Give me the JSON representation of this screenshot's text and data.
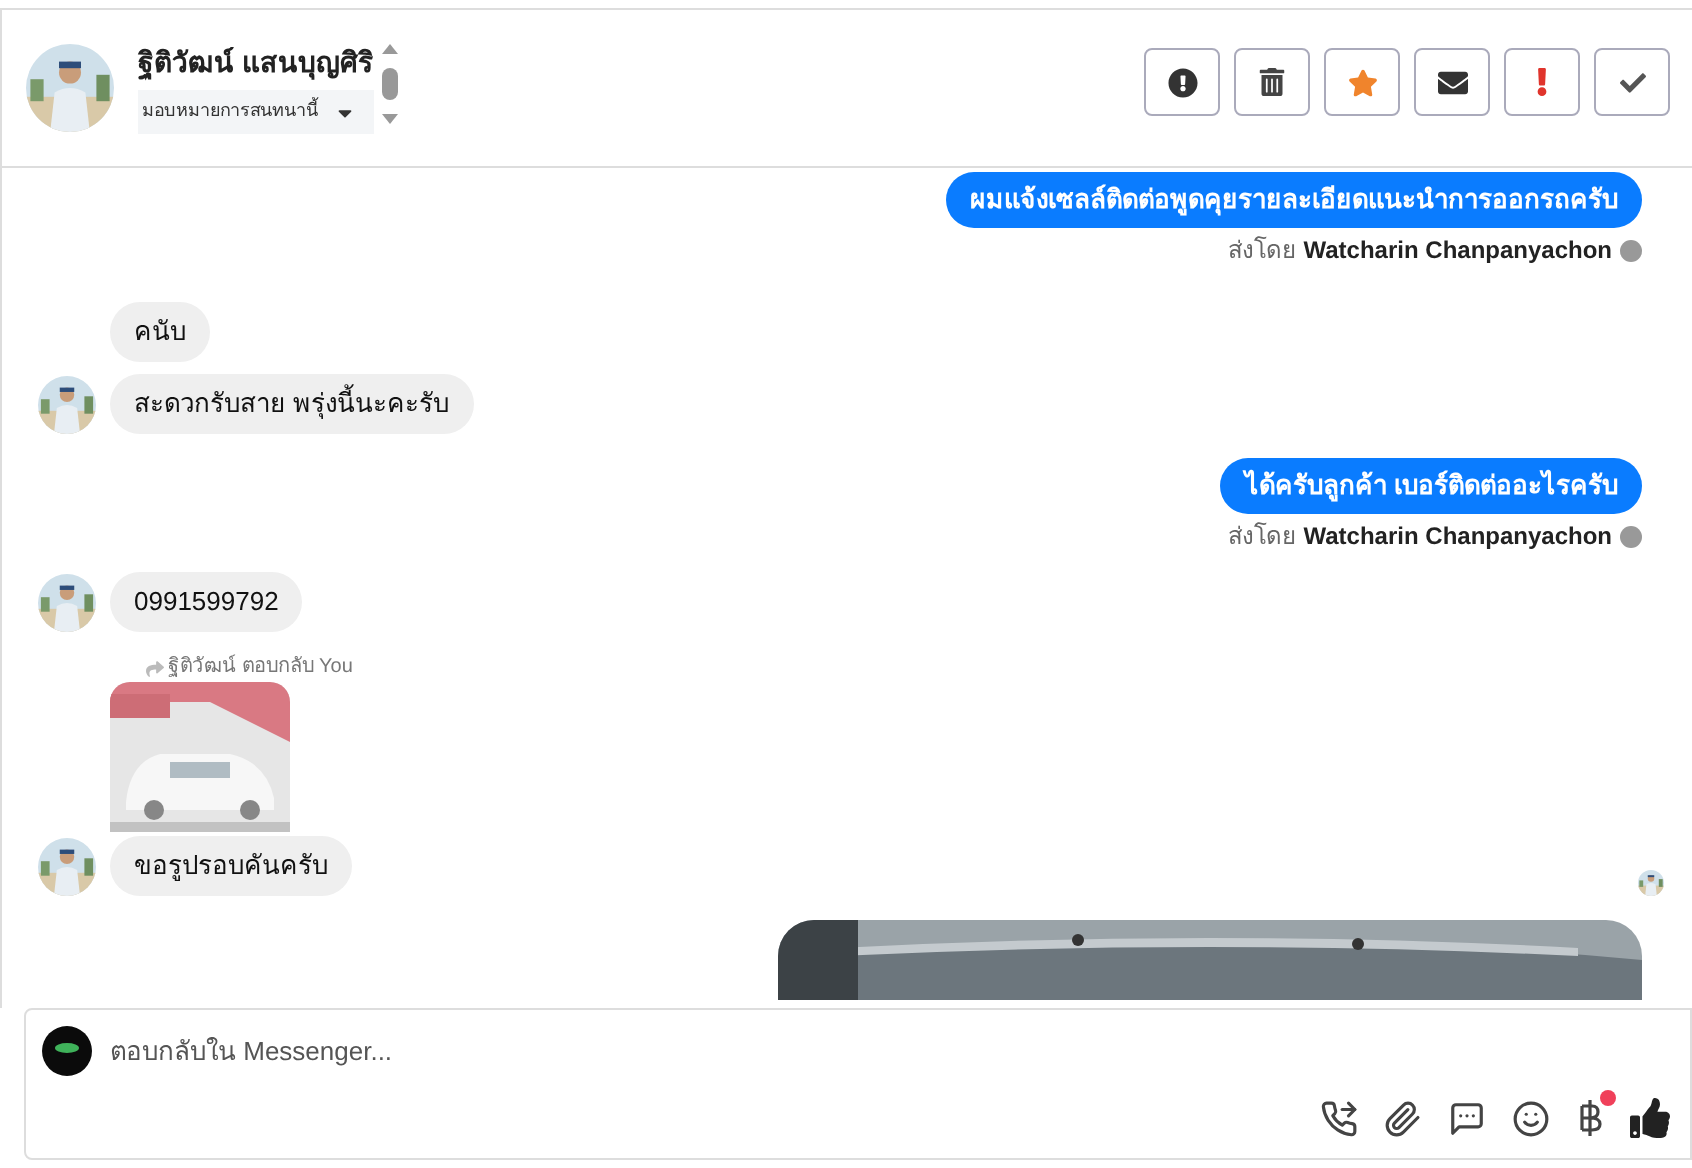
{
  "header": {
    "name": "ฐิติวัฒน์ แสนบุญศิริ",
    "assign": "มอบหมายการสนทนานี้"
  },
  "actions": [
    {
      "kind": "alert"
    },
    {
      "kind": "trash"
    },
    {
      "kind": "star"
    },
    {
      "kind": "mail"
    },
    {
      "kind": "important"
    },
    {
      "kind": "done"
    }
  ],
  "messages": [
    {
      "kind": "out",
      "text": "ผมแจ้งเซลล์ติดต่อพูดคุยรายละเอียดแนะนำการออกรถครับ",
      "sent_by_label": "ส่งโดย",
      "sent_by": "Watcharin Chanpanyachon"
    },
    {
      "kind": "in",
      "text": "คนับ",
      "avatar": false
    },
    {
      "kind": "in",
      "text": "สะดวกรับสาย พรุ่งนี้นะคะรับ",
      "avatar": true
    },
    {
      "kind": "out",
      "text": "ได้ครับลูกค้า เบอร์ติดต่ออะไรครับ",
      "sent_by_label": "ส่งโดย",
      "sent_by": "Watcharin Chanpanyachon"
    },
    {
      "kind": "in",
      "text": "0991599792",
      "avatar": true
    },
    {
      "kind": "reply",
      "label": "ฐิติวัฒน์ ตอบกลับ You"
    },
    {
      "kind": "in",
      "text": "ขอรูปรอบคันครับ",
      "avatar": true,
      "seen": true
    },
    {
      "kind": "image_out"
    }
  ],
  "composer": {
    "placeholder": "ตอบกลับใน Messenger..."
  },
  "tools": [
    {
      "kind": "call"
    },
    {
      "kind": "attach"
    },
    {
      "kind": "chat"
    },
    {
      "kind": "emoji"
    },
    {
      "kind": "baht",
      "badge": true
    },
    {
      "kind": "like"
    }
  ]
}
